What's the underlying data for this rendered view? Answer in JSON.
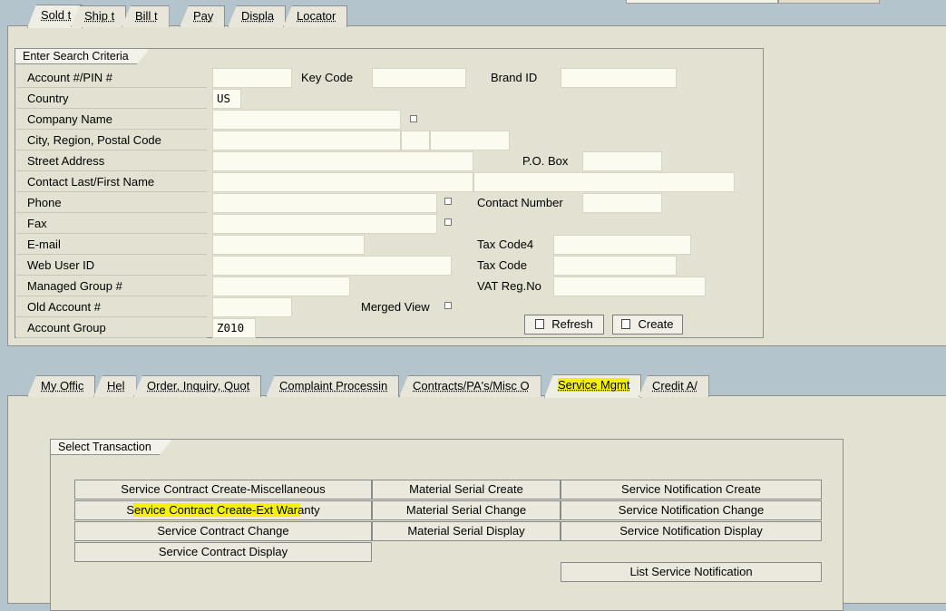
{
  "top_tabs": [
    "Sold t",
    "Ship t",
    "Bill t",
    "Pay",
    "Displa",
    "Locator"
  ],
  "search": {
    "group_title": "Enter Search Criteria",
    "account_label": "Account #/PIN #",
    "key_code_label": "Key Code",
    "brand_id_label": "Brand ID",
    "country_label": "Country",
    "country_value": "US",
    "company_label": "Company Name",
    "city_label": "City, Region, Postal Code",
    "street_label": "Street Address",
    "po_box_label": "P.O. Box",
    "contact_label": "Contact Last/First Name",
    "phone_label": "Phone",
    "contact_number_label": "Contact Number",
    "fax_label": "Fax",
    "email_label": "E-mail",
    "tax_code4_label": "Tax Code4",
    "web_user_label": "Web User ID",
    "tax_code_label": "Tax Code",
    "managed_group_label": "Managed Group #",
    "vat_label": "VAT Reg.No",
    "old_account_label": "Old Account #",
    "merged_view_label": "Merged View",
    "account_group_label": "Account Group",
    "account_group_value": "Z010",
    "refresh_label": "Refresh",
    "create_label": "Create"
  },
  "bottom_tabs": [
    "My Offic",
    "Hel",
    "Order, Inquiry, Quot",
    "Complaint Processin",
    "Contracts/PA's/Misc O",
    "Service Mgmt",
    "Credit A/"
  ],
  "transactions": {
    "group_title": "Select Transaction",
    "col1": [
      "Service Contract Create-Miscellaneous",
      "Service Contract Create-Ext Waranty",
      "Service Contract Change",
      "Service Contract Display"
    ],
    "col2": [
      "Material Serial Create",
      "Material Serial Change",
      "Material Serial Display"
    ],
    "col3": [
      "Service Notification Create",
      "Service Notification Change",
      "Service Notification Display",
      "List Service Notification"
    ]
  },
  "colors": {
    "highlight": "#f4f200",
    "panel": "#e3e1d1",
    "background": "#b3c4cd"
  }
}
